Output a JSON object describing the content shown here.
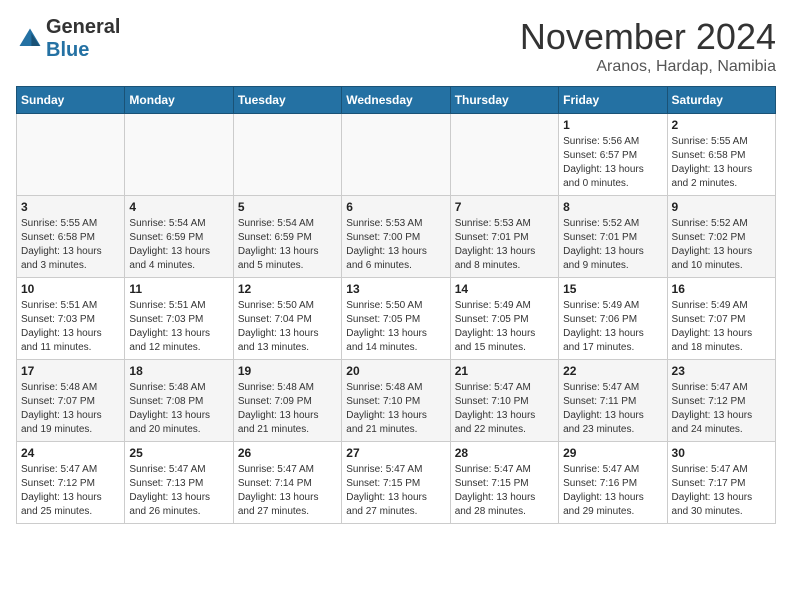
{
  "header": {
    "logo_general": "General",
    "logo_blue": "Blue",
    "month_title": "November 2024",
    "subtitle": "Aranos, Hardap, Namibia"
  },
  "weekdays": [
    "Sunday",
    "Monday",
    "Tuesday",
    "Wednesday",
    "Thursday",
    "Friday",
    "Saturday"
  ],
  "weeks": [
    [
      {
        "day": "",
        "info": ""
      },
      {
        "day": "",
        "info": ""
      },
      {
        "day": "",
        "info": ""
      },
      {
        "day": "",
        "info": ""
      },
      {
        "day": "",
        "info": ""
      },
      {
        "day": "1",
        "info": "Sunrise: 5:56 AM\nSunset: 6:57 PM\nDaylight: 13 hours and 0 minutes."
      },
      {
        "day": "2",
        "info": "Sunrise: 5:55 AM\nSunset: 6:58 PM\nDaylight: 13 hours and 2 minutes."
      }
    ],
    [
      {
        "day": "3",
        "info": "Sunrise: 5:55 AM\nSunset: 6:58 PM\nDaylight: 13 hours and 3 minutes."
      },
      {
        "day": "4",
        "info": "Sunrise: 5:54 AM\nSunset: 6:59 PM\nDaylight: 13 hours and 4 minutes."
      },
      {
        "day": "5",
        "info": "Sunrise: 5:54 AM\nSunset: 6:59 PM\nDaylight: 13 hours and 5 minutes."
      },
      {
        "day": "6",
        "info": "Sunrise: 5:53 AM\nSunset: 7:00 PM\nDaylight: 13 hours and 6 minutes."
      },
      {
        "day": "7",
        "info": "Sunrise: 5:53 AM\nSunset: 7:01 PM\nDaylight: 13 hours and 8 minutes."
      },
      {
        "day": "8",
        "info": "Sunrise: 5:52 AM\nSunset: 7:01 PM\nDaylight: 13 hours and 9 minutes."
      },
      {
        "day": "9",
        "info": "Sunrise: 5:52 AM\nSunset: 7:02 PM\nDaylight: 13 hours and 10 minutes."
      }
    ],
    [
      {
        "day": "10",
        "info": "Sunrise: 5:51 AM\nSunset: 7:03 PM\nDaylight: 13 hours and 11 minutes."
      },
      {
        "day": "11",
        "info": "Sunrise: 5:51 AM\nSunset: 7:03 PM\nDaylight: 13 hours and 12 minutes."
      },
      {
        "day": "12",
        "info": "Sunrise: 5:50 AM\nSunset: 7:04 PM\nDaylight: 13 hours and 13 minutes."
      },
      {
        "day": "13",
        "info": "Sunrise: 5:50 AM\nSunset: 7:05 PM\nDaylight: 13 hours and 14 minutes."
      },
      {
        "day": "14",
        "info": "Sunrise: 5:49 AM\nSunset: 7:05 PM\nDaylight: 13 hours and 15 minutes."
      },
      {
        "day": "15",
        "info": "Sunrise: 5:49 AM\nSunset: 7:06 PM\nDaylight: 13 hours and 17 minutes."
      },
      {
        "day": "16",
        "info": "Sunrise: 5:49 AM\nSunset: 7:07 PM\nDaylight: 13 hours and 18 minutes."
      }
    ],
    [
      {
        "day": "17",
        "info": "Sunrise: 5:48 AM\nSunset: 7:07 PM\nDaylight: 13 hours and 19 minutes."
      },
      {
        "day": "18",
        "info": "Sunrise: 5:48 AM\nSunset: 7:08 PM\nDaylight: 13 hours and 20 minutes."
      },
      {
        "day": "19",
        "info": "Sunrise: 5:48 AM\nSunset: 7:09 PM\nDaylight: 13 hours and 21 minutes."
      },
      {
        "day": "20",
        "info": "Sunrise: 5:48 AM\nSunset: 7:10 PM\nDaylight: 13 hours and 21 minutes."
      },
      {
        "day": "21",
        "info": "Sunrise: 5:47 AM\nSunset: 7:10 PM\nDaylight: 13 hours and 22 minutes."
      },
      {
        "day": "22",
        "info": "Sunrise: 5:47 AM\nSunset: 7:11 PM\nDaylight: 13 hours and 23 minutes."
      },
      {
        "day": "23",
        "info": "Sunrise: 5:47 AM\nSunset: 7:12 PM\nDaylight: 13 hours and 24 minutes."
      }
    ],
    [
      {
        "day": "24",
        "info": "Sunrise: 5:47 AM\nSunset: 7:12 PM\nDaylight: 13 hours and 25 minutes."
      },
      {
        "day": "25",
        "info": "Sunrise: 5:47 AM\nSunset: 7:13 PM\nDaylight: 13 hours and 26 minutes."
      },
      {
        "day": "26",
        "info": "Sunrise: 5:47 AM\nSunset: 7:14 PM\nDaylight: 13 hours and 27 minutes."
      },
      {
        "day": "27",
        "info": "Sunrise: 5:47 AM\nSunset: 7:15 PM\nDaylight: 13 hours and 27 minutes."
      },
      {
        "day": "28",
        "info": "Sunrise: 5:47 AM\nSunset: 7:15 PM\nDaylight: 13 hours and 28 minutes."
      },
      {
        "day": "29",
        "info": "Sunrise: 5:47 AM\nSunset: 7:16 PM\nDaylight: 13 hours and 29 minutes."
      },
      {
        "day": "30",
        "info": "Sunrise: 5:47 AM\nSunset: 7:17 PM\nDaylight: 13 hours and 30 minutes."
      }
    ]
  ]
}
